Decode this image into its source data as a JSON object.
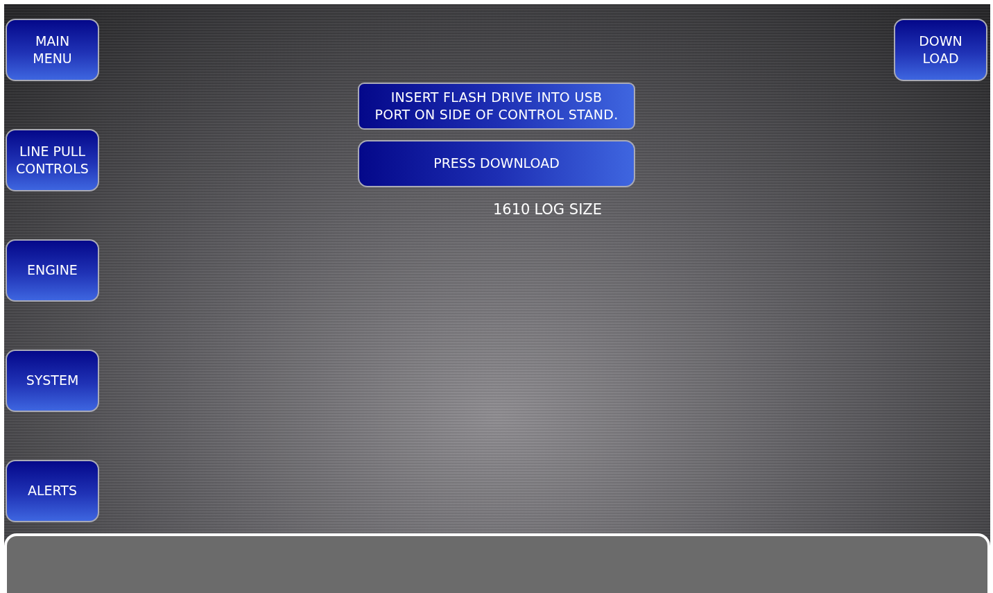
{
  "nav_buttons": [
    {
      "label": "MAIN\nMENU"
    },
    {
      "label": "LINE PULL\nCONTROLS"
    },
    {
      "label": "ENGINE"
    },
    {
      "label": "SYSTEM"
    },
    {
      "label": "ALERTS"
    }
  ],
  "download_button": {
    "label": "DOWN\nLOAD"
  },
  "instruction": "INSERT FLASH DRIVE INTO USB\nPORT ON SIDE OF CONTROL STAND.",
  "action_button": {
    "label": "PRESS DOWNLOAD"
  },
  "log_size": {
    "value": "1610",
    "label": "LOG SIZE"
  }
}
